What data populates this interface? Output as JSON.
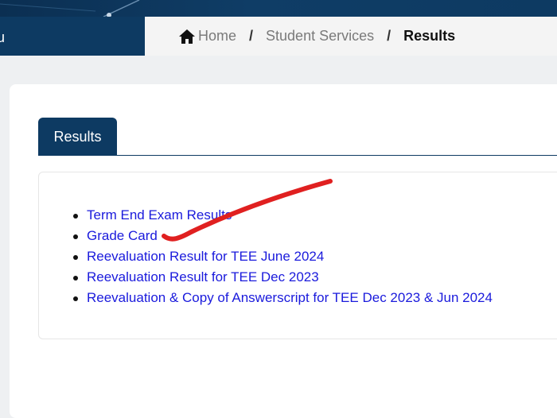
{
  "header": {
    "nav_fragment": "u"
  },
  "breadcrumb": {
    "home_icon": "home-icon",
    "home": "Home",
    "separator": "/",
    "section": "Student Services",
    "current": "Results"
  },
  "tabs": [
    {
      "label": "Results"
    }
  ],
  "results_list": [
    {
      "label": "Term End Exam Results"
    },
    {
      "label": "Grade Card"
    },
    {
      "label": "Reevaluation Result for TEE June 2024"
    },
    {
      "label": "Reevaluation Result for TEE Dec 2023"
    },
    {
      "label": "Reevaluation & Copy of Answerscript for TEE Dec 2023 & Jun 2024"
    }
  ],
  "colors": {
    "primary_dark": "#0d3a62",
    "link": "#1a1adc",
    "annotation": "#e02020"
  }
}
